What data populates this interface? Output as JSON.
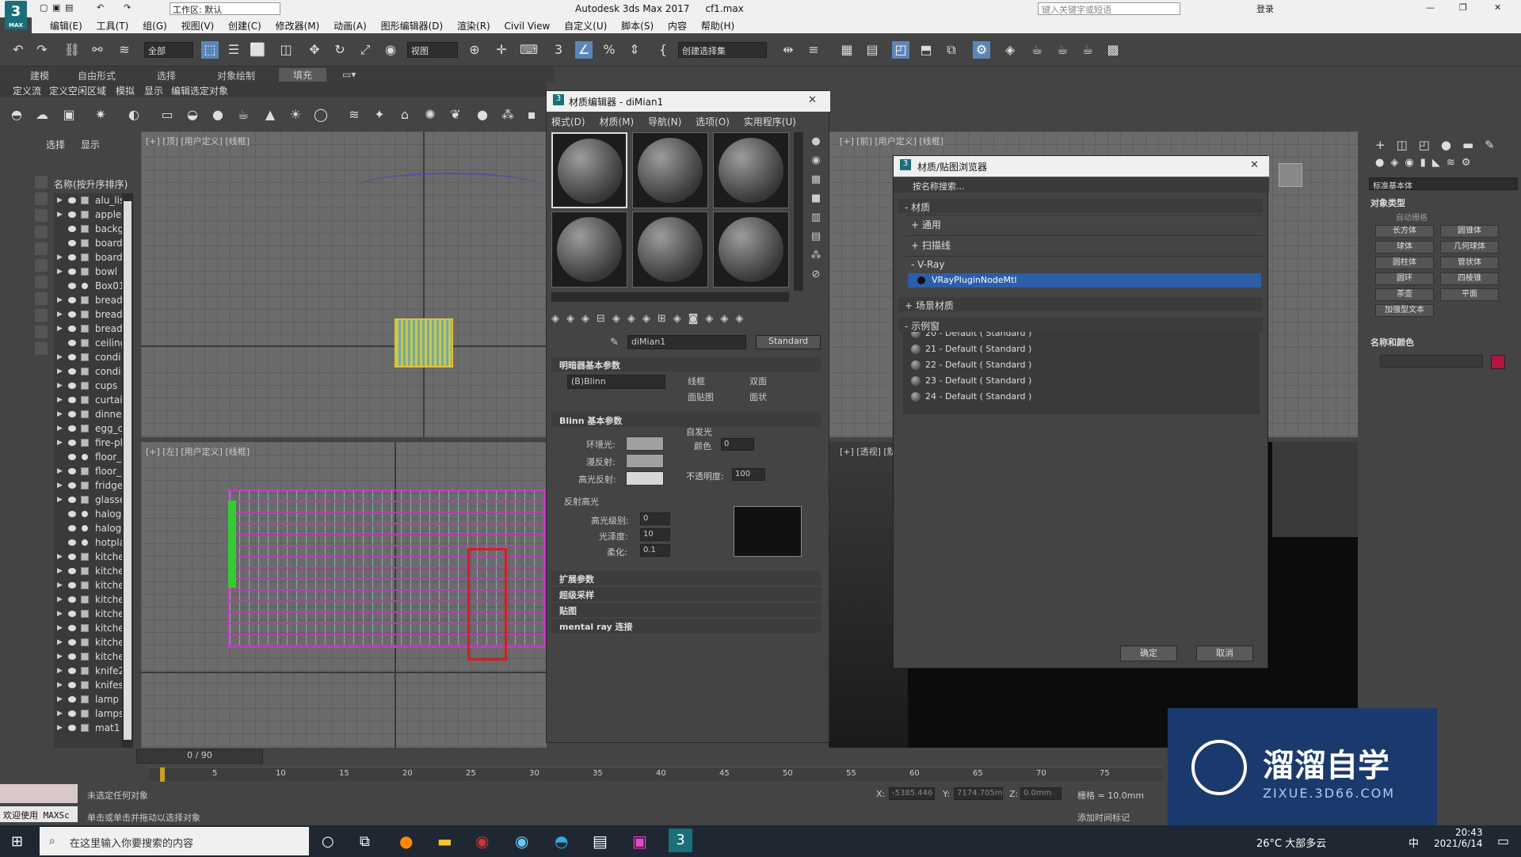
{
  "app": {
    "title": "Autodesk 3ds Max 2017",
    "file": "cf1.max",
    "logo": "3",
    "logo_sub": "MAX",
    "workspace": "工作区: 默认",
    "search_placeholder": "键入关键字或短语",
    "login": "登录"
  },
  "menu": [
    "编辑(E)",
    "工具(T)",
    "组(G)",
    "视图(V)",
    "创建(C)",
    "修改器(M)",
    "动画(A)",
    "图形编辑器(D)",
    "渲染(R)",
    "Civil View",
    "自定义(U)",
    "脚本(S)",
    "内容",
    "帮助(H)"
  ],
  "toolbar": {
    "filter": "全部",
    "view": "视图",
    "selection_set": "创建选择集"
  },
  "ribbon": {
    "tabs": [
      "建模",
      "自由形式",
      "选择",
      "对象绘制",
      "填充"
    ],
    "row": [
      "定义流",
      "定义空闲区域",
      "模拟",
      "显示",
      "编辑选定对象"
    ]
  },
  "scene": {
    "tabs": [
      "选择",
      "显示"
    ],
    "header": "名称(按升序排序)",
    "items": [
      "alu_lis",
      "apples",
      "backg",
      "board",
      "board",
      "bowl",
      "Box01",
      "bread",
      "bread",
      "bread",
      "ceiling",
      "condi",
      "condi",
      "cups",
      "curtai",
      "dinne",
      "egg_c",
      "fire-pl",
      "floor_",
      "floor_",
      "fridge",
      "glasse",
      "haloge",
      "haloge",
      "hotpla",
      "kitche",
      "kitche",
      "kitche",
      "kitche",
      "kitche",
      "kitche",
      "kitche",
      "kitche",
      "knife2",
      "knifes",
      "lamp",
      "lamps",
      "mat1"
    ]
  },
  "viewports": {
    "top_left": "[+] [顶] [用户定义] [线框]",
    "bottom_left": "[+] [左] [用户定义] [线框]",
    "top_right": "[+] [前] [用户定义] [线框]",
    "bottom_right": "[+] [透视] [默认明暗处理]"
  },
  "material_editor": {
    "title": "材质编辑器 - diMian1",
    "menu": [
      "模式(D)",
      "材质(M)",
      "导航(N)",
      "选项(O)",
      "实用程序(U)"
    ],
    "mat_name": "diMian1",
    "mat_type": "Standard",
    "shader_section": "明暗器基本参数",
    "shader": "(B)Blinn",
    "checks": [
      "线框",
      "双面",
      "面贴图",
      "面状"
    ],
    "blinn_section": "Blinn 基本参数",
    "self_illum": "自发光",
    "color_label": "颜色",
    "color_value": "0",
    "ambient": "环境光:",
    "diffuse": "漫反射:",
    "specular": "高光反射:",
    "opacity_label": "不透明度:",
    "opacity": "100",
    "spec_hl": "反射高光",
    "spec_level_label": "高光级别:",
    "spec_level": "0",
    "gloss_label": "光泽度:",
    "gloss": "10",
    "soften_label": "柔化:",
    "soften": "0.1",
    "rollouts": [
      "扩展参数",
      "超级采样",
      "贴图",
      "mental ray 连接"
    ]
  },
  "browser": {
    "title": "材质/贴图浏览器",
    "search": "按名称搜索...",
    "materials": "- 材质",
    "general": "+ 通用",
    "scanline": "+ 扫描线",
    "vray": "- V-Ray",
    "vray_item": "VRayPluginNodeMtl",
    "scene_mat": "+ 场景材质",
    "samples": "- 示例窗",
    "sample_items": [
      "20 - Default ( Standard )",
      "21 - Default ( Standard )",
      "22 - Default ( Standard )",
      "23 - Default ( Standard )",
      "24 - Default ( Standard )"
    ],
    "ok": "确定",
    "cancel": "取消"
  },
  "command_panel": {
    "category": "标准基本体",
    "object_type": "对象类型",
    "autogrid": "自动栅格",
    "buttons": [
      "长方体",
      "圆锥体",
      "球体",
      "几何球体",
      "圆柱体",
      "管状体",
      "圆环",
      "四棱锥",
      "茶壶",
      "平面",
      "加强型文本"
    ],
    "name_color": "名称和颜色",
    "color": "#b01640"
  },
  "timeline": {
    "frame": "0 / 90",
    "ticks": [
      "5",
      "10",
      "15",
      "20",
      "25",
      "30",
      "35",
      "40",
      "45",
      "50",
      "55",
      "60",
      "65",
      "70",
      "75"
    ]
  },
  "status": {
    "welcome": "欢迎使用 MAXSc",
    "line1": "未选定任何对象",
    "line2": "单击或单击并拖动以选择对象",
    "x_label": "X:",
    "x": "-5385.446",
    "y_label": "Y:",
    "y": "7174.705m",
    "z_label": "Z:",
    "z": "0.0mm",
    "grid": "栅格 = 10.0mm",
    "add_time_tag": "添加时间标记"
  },
  "taskbar": {
    "search": "在这里输入你要搜索的内容",
    "weather": "26°C 大部多云",
    "time": "20:43",
    "date": "2021/6/14",
    "ime": "中"
  },
  "watermark": {
    "name": "溜溜自学",
    "url": "ZIXUE.3D66.COM"
  }
}
